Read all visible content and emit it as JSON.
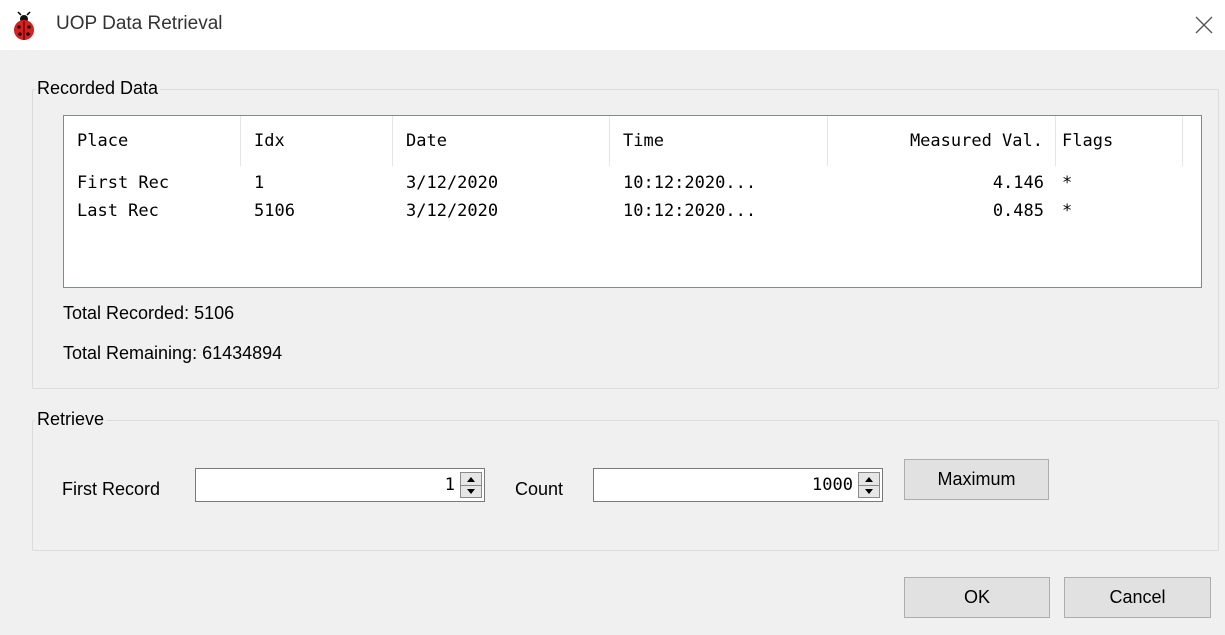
{
  "window": {
    "title": "UOP Data Retrieval",
    "icon": "ladybug-icon",
    "close_icon": "close-icon"
  },
  "recorded": {
    "group_label": "Recorded Data",
    "columns": [
      "Place",
      "Idx",
      "Date",
      "Time",
      "Measured Val.",
      "Flags"
    ],
    "rows": [
      [
        "First Rec",
        "1",
        "3/12/2020",
        "10:12:2020...",
        "4.146",
        "*"
      ],
      [
        "Last Rec",
        "5106",
        "3/12/2020",
        "10:12:2020...",
        "0.485",
        "*"
      ]
    ],
    "total_recorded": "Total Recorded: 5106",
    "total_remaining": "Total Remaining: 61434894"
  },
  "retrieve": {
    "group_label": "Retrieve",
    "first_record_label": "First Record",
    "first_record_value": "1",
    "count_label": "Count",
    "count_value": "1000",
    "maximum_label": "Maximum"
  },
  "buttons": {
    "ok": "OK",
    "cancel": "Cancel"
  },
  "colors": {
    "dialog_bg": "#f0f0f0",
    "titlebar_bg": "#ffffff",
    "icon_red": "#d81e1e"
  }
}
